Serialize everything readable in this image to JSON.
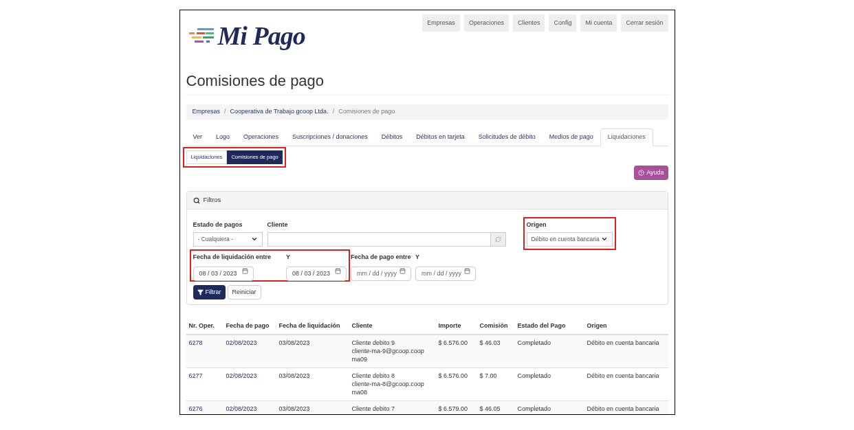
{
  "logo": {
    "text": "Mi Pago"
  },
  "nav": [
    "Empresas",
    "Operaciones",
    "Clientes",
    "Config",
    "Mi cuenta",
    "Cerrar sesión"
  ],
  "title": "Comisiones de pago",
  "breadcrumb_separator": "/",
  "breadcrumb": [
    {
      "label": "Empresas",
      "link": true
    },
    {
      "label": "Cooperativa de Trabajo gcoop Ltda.",
      "link": true
    },
    {
      "label": "Comisiones de pago",
      "link": false
    }
  ],
  "tabs": [
    {
      "label": "Ver",
      "selected": false
    },
    {
      "label": "Logo",
      "selected": false
    },
    {
      "label": "Operaciones",
      "selected": false
    },
    {
      "label": "Suscripciones / donaciones",
      "selected": false
    },
    {
      "label": "Débitos",
      "selected": false
    },
    {
      "label": "Débitos en tarjeta",
      "selected": false
    },
    {
      "label": "Solicitudes de débito",
      "selected": false
    },
    {
      "label": "Medios de pago",
      "selected": false
    },
    {
      "label": "Liquidaciones",
      "selected": true
    }
  ],
  "subtabs": {
    "highlighted": true,
    "items": [
      {
        "label": "Liquidaciones",
        "selected": false
      },
      {
        "label": "Comisiones de pago",
        "selected": true
      }
    ]
  },
  "help_button": "Ayuda",
  "filters": {
    "title": "Filtros",
    "estado": {
      "label": "Estado de pagos",
      "value": "- Cualquiera -"
    },
    "cliente": {
      "label": "Cliente"
    },
    "origen": {
      "label": "Origen",
      "value": "Débito en cuenta bancaria",
      "highlighted": true
    },
    "fecha_liquidacion": {
      "label": "Fecha de liquidación entre",
      "from": "08 / 03 / 2023",
      "to_label": "Y",
      "to": "08 / 03 / 2023",
      "highlighted": true
    },
    "fecha_pago": {
      "label": "Fecha de pago entre",
      "from_placeholder": "mm / dd / yyyy",
      "to_label": "Y",
      "to_placeholder": "mm / dd / yyyy"
    },
    "filter_button": "Filtrar",
    "reset_button": "Reiniciar"
  },
  "table": {
    "columns": [
      "Nr. Oper.",
      "Fecha de pago",
      "Fecha de liquidación",
      "Cliente",
      "Importe",
      "Comisión",
      "Estado del Pago",
      "Origen"
    ],
    "rows": [
      {
        "nr": "6278",
        "fecha_pago": "02/08/2023",
        "fecha_liquidacion": "03/08/2023",
        "cliente": [
          "Cliente debito 9",
          "cliente-ma-9@gcoop.coop",
          "ma09"
        ],
        "importe": "$ 6.576.00",
        "comision": "$ 46.03",
        "estado": "Completado",
        "origen": "Débito en cuenta bancaria"
      },
      {
        "nr": "6277",
        "fecha_pago": "02/08/2023",
        "fecha_liquidacion": "03/08/2023",
        "cliente": [
          "Cliente debito 8",
          "cliente-ma-8@gcoop.coop",
          "ma08"
        ],
        "importe": "$ 6.576.00",
        "comision": "$ 7.00",
        "estado": "Completado",
        "origen": "Débito en cuenta bancaria"
      },
      {
        "nr": "6276",
        "fecha_pago": "02/08/2023",
        "fecha_liquidacion": "03/08/2023",
        "cliente": [
          "Cliente debito 7"
        ],
        "importe": "$ 6.579.00",
        "comision": "$ 46.05",
        "estado": "Completado",
        "origen": "Débito en cuenta bancaria"
      }
    ]
  }
}
